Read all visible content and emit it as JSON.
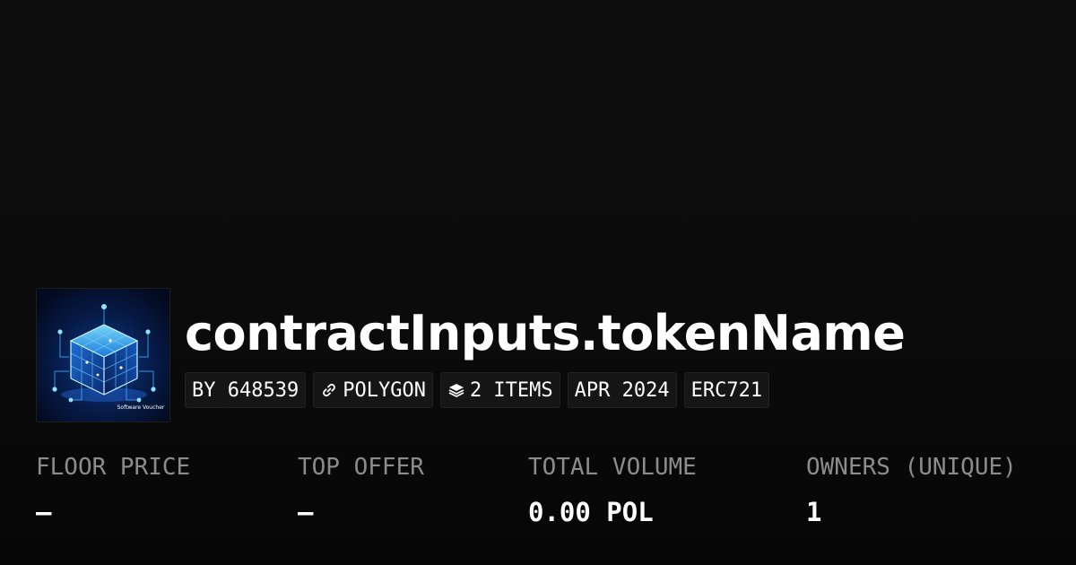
{
  "collection": {
    "title": "contractInputs.tokenName",
    "thumbnail_caption": "Software Voucher"
  },
  "tags": [
    {
      "label": "BY 648539",
      "icon": ""
    },
    {
      "label": "POLYGON",
      "icon": "link-icon"
    },
    {
      "label": "2 ITEMS",
      "icon": "layers-icon"
    },
    {
      "label": "APR 2024",
      "icon": ""
    },
    {
      "label": "ERC721",
      "icon": ""
    }
  ],
  "stats": [
    {
      "label": "FLOOR PRICE",
      "value": "–"
    },
    {
      "label": "TOP OFFER",
      "value": "–"
    },
    {
      "label": "TOTAL VOLUME",
      "value": "0.00 POL"
    },
    {
      "label": "OWNERS (UNIQUE)",
      "value": "1"
    }
  ],
  "colors": {
    "background": "#0b0b0b",
    "tag_background": "#161616",
    "label_gray": "#8c8c8c",
    "text": "#ffffff",
    "thumb_accent": "#2fa8ff"
  }
}
